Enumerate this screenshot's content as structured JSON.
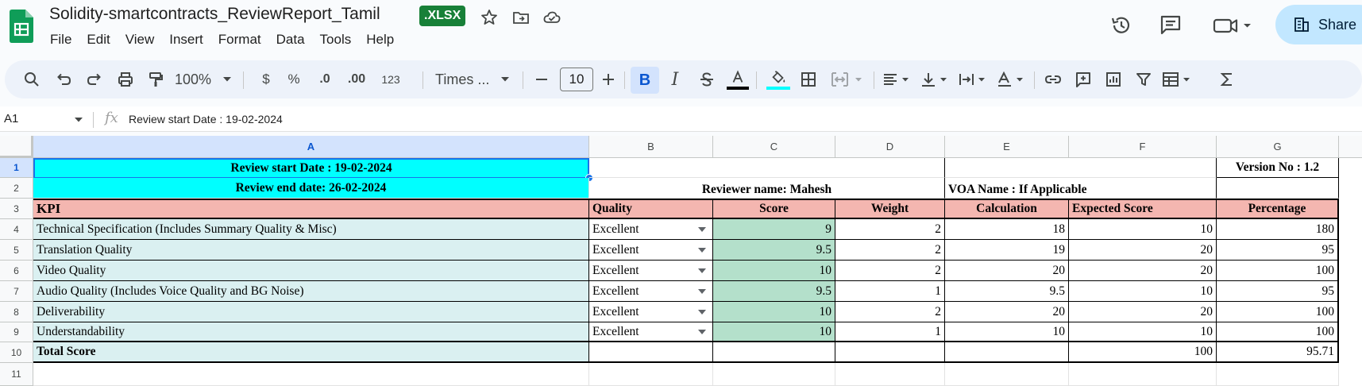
{
  "document": {
    "title": "Solidity-smartcontracts_ReviewReport_Tamil",
    "badge": ".XLSX"
  },
  "menu": [
    "File",
    "Edit",
    "View",
    "Insert",
    "Format",
    "Data",
    "Tools",
    "Help"
  ],
  "share_label": "Share",
  "toolbar": {
    "zoom": "100%",
    "currency": "$",
    "percent": "%",
    "decrease_decimals": ".0",
    "increase_decimals": ".00",
    "number_format": "123",
    "font": "Times ...",
    "font_size": "10",
    "bold": "B",
    "italic": "I"
  },
  "formula_bar": {
    "cell_ref": "A1",
    "fx": "fx",
    "content": "Review start Date : 19-02-2024"
  },
  "columns": [
    "A",
    "B",
    "C",
    "D",
    "E",
    "F",
    "G"
  ],
  "rows": [
    "1",
    "2",
    "3",
    "4",
    "5",
    "6",
    "7",
    "8",
    "9",
    "10",
    "11"
  ],
  "sheet": {
    "review_start": "Review start Date : 19-02-2024",
    "review_end": "Review end date:  26-02-2024",
    "reviewer": "Reviewer name: Mahesh",
    "voa": "VOA Name : If Applicable",
    "version": "Version No : 1.2",
    "headers": [
      "KPI",
      "Quality",
      "Score",
      "Weight",
      "Calculation",
      "Expected Score",
      "Percentage"
    ],
    "data_rows": [
      {
        "kpi": "Technical Specification (Includes Summary Quality & Misc)",
        "quality": "Excellent",
        "score": "9",
        "weight": "2",
        "calculation": "18",
        "expected": "10",
        "percentage": "180"
      },
      {
        "kpi": "Translation Quality",
        "quality": "Excellent",
        "score": "9.5",
        "weight": "2",
        "calculation": "19",
        "expected": "20",
        "percentage": "95"
      },
      {
        "kpi": "Video Quality",
        "quality": "Excellent",
        "score": "10",
        "weight": "2",
        "calculation": "20",
        "expected": "20",
        "percentage": "100"
      },
      {
        "kpi": "Audio Quality (Includes Voice Quality and BG Noise)",
        "quality": "Excellent",
        "score": "9.5",
        "weight": "1",
        "calculation": "9.5",
        "expected": "10",
        "percentage": "95"
      },
      {
        "kpi": "Deliverability",
        "quality": "Excellent",
        "score": "10",
        "weight": "2",
        "calculation": "20",
        "expected": "20",
        "percentage": "100"
      },
      {
        "kpi": "Understandability",
        "quality": "Excellent",
        "score": "10",
        "weight": "1",
        "calculation": "10",
        "expected": "10",
        "percentage": "100"
      }
    ],
    "total_label": "Total Score",
    "total_expected": "100",
    "total_percentage": "95.71"
  }
}
